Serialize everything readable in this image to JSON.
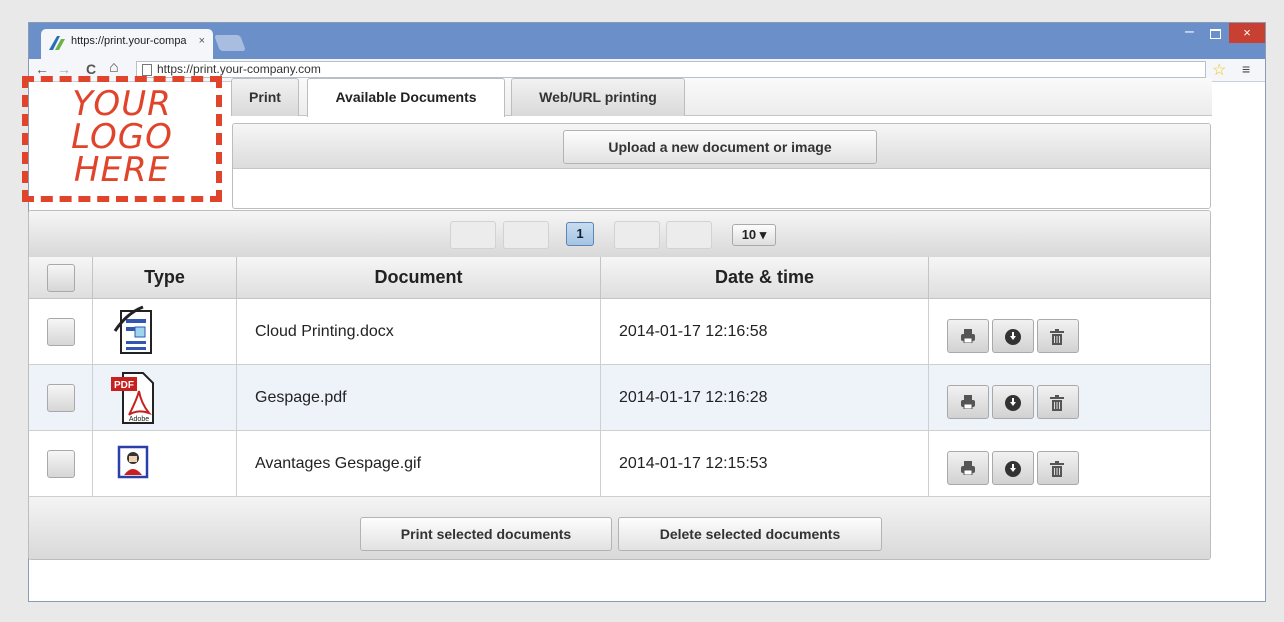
{
  "browser": {
    "tab_title": "https://print.your-compa",
    "tab_close": "×",
    "window_min": "–",
    "window_close": "×",
    "address": "https://print.your-company.com",
    "back": "←",
    "forward": "→",
    "reload": "C",
    "home": "⌂",
    "star": "☆",
    "menu": "≡"
  },
  "logo": {
    "line1": "YOUR",
    "line2": "LOGO",
    "line3": "HERE"
  },
  "tabs": [
    {
      "label": "Print"
    },
    {
      "label": "Available Documents",
      "active": true
    },
    {
      "label": "Web/URL printing"
    }
  ],
  "upload_button": "Upload a new document or image",
  "pager": {
    "current_page": "1",
    "page_size": "10 ▾"
  },
  "columns": {
    "type": "Type",
    "document": "Document",
    "date": "Date & time"
  },
  "rows": [
    {
      "name": "Cloud Printing.docx",
      "date": "2014-01-17 12:16:58",
      "type": "docx"
    },
    {
      "name": "Gespage.pdf",
      "date": "2014-01-17 12:16:28",
      "type": "pdf",
      "badge": "PDF",
      "brand": "Adobe"
    },
    {
      "name": "Avantages Gespage.gif",
      "date": "2014-01-17 12:15:53",
      "type": "gif"
    }
  ],
  "actions": {
    "print_selected": "Print selected documents",
    "delete_selected": "Delete selected documents"
  },
  "colors": {
    "accent_red": "#e0442a",
    "browser_blue": "#6b8fc9",
    "row_alt": "#eef3fa"
  }
}
